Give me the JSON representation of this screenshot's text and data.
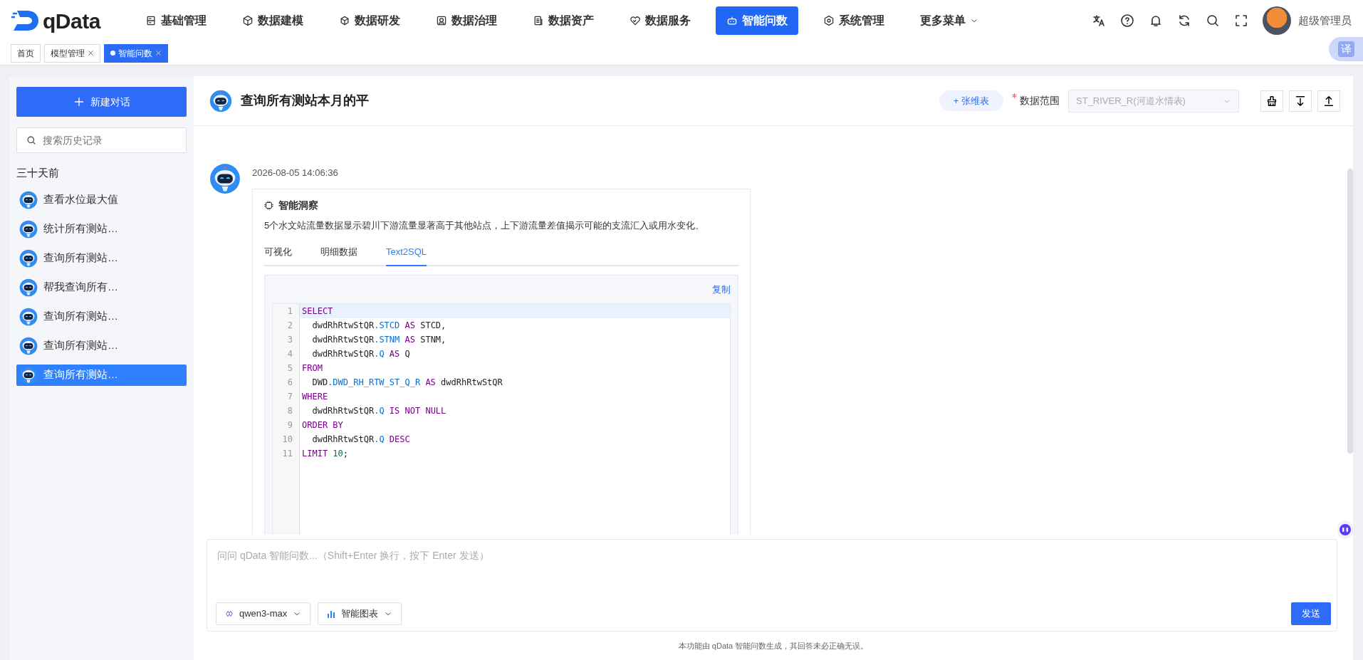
{
  "logo": {
    "text": "qData"
  },
  "nav": [
    {
      "label": "基础管理",
      "kind": "server",
      "selected": false
    },
    {
      "label": "数据建模",
      "kind": "cube",
      "selected": false
    },
    {
      "label": "数据研发",
      "kind": "box",
      "selected": false
    },
    {
      "label": "数据治理",
      "kind": "frame",
      "selected": false
    },
    {
      "label": "数据资产",
      "kind": "doc",
      "selected": false
    },
    {
      "label": "数据服务",
      "kind": "heart",
      "selected": false
    },
    {
      "label": "智能问数",
      "kind": "robot",
      "selected": true
    },
    {
      "label": "系统管理",
      "kind": "hex",
      "selected": false
    }
  ],
  "more_menu": {
    "label": "更多菜单"
  },
  "user": {
    "name": "超级管理员"
  },
  "translate_button": {
    "label": "译"
  },
  "page_tabs": [
    {
      "label": "首页",
      "closable": false,
      "selected": false
    },
    {
      "label": "模型管理",
      "closable": true,
      "selected": false
    },
    {
      "label": "智能问数",
      "closable": true,
      "selected": true
    }
  ],
  "sidebar": {
    "new_button": "新建对话",
    "search_placeholder": "搜索历史记录",
    "group": "三十天前",
    "items": [
      {
        "label": "查看水位最大值",
        "selected": false
      },
      {
        "label": "统计所有测站…",
        "selected": false
      },
      {
        "label": "查询所有测站…",
        "selected": false
      },
      {
        "label": "帮我查询所有…",
        "selected": false
      },
      {
        "label": "查询所有测站…",
        "selected": false
      },
      {
        "label": "查询所有测站…",
        "selected": false
      },
      {
        "label": "查询所有测站…",
        "selected": true
      }
    ]
  },
  "header": {
    "title": "查询所有测站本月的平",
    "user_tag": "+ 张维表",
    "scope_label": "数据范围",
    "scope_value": "ST_RIVER_R(河道水情表)"
  },
  "message": {
    "time": "2026-08-05 14:06:36",
    "insight_title": "智能洞察",
    "insight": "5个水文站流量数据显示碧川下游流量显著高于其他站点，上下游流量差值揭示可能的支流汇入或用水变化。",
    "tabs": [
      {
        "label": "可视化",
        "selected": false
      },
      {
        "label": "明细数据",
        "selected": false
      },
      {
        "label": "Text2SQL",
        "selected": true
      }
    ],
    "copy": "复制",
    "code": [
      {
        "n": "1",
        "active": true,
        "tokens": [
          {
            "t": "SELECT",
            "kind": "keyword"
          }
        ]
      },
      {
        "n": "2",
        "active": false,
        "tokens": [
          {
            "t": "  dwdRhRtwStQR",
            "kind": "plain"
          },
          {
            "t": ".STCD",
            "kind": "field"
          },
          {
            "t": " AS",
            "kind": "keyword"
          },
          {
            "t": " STCD,",
            "kind": "plain"
          }
        ]
      },
      {
        "n": "3",
        "active": false,
        "tokens": [
          {
            "t": "  dwdRhRtwStQR",
            "kind": "plain"
          },
          {
            "t": ".STNM",
            "kind": "field"
          },
          {
            "t": " AS",
            "kind": "keyword"
          },
          {
            "t": " STNM,",
            "kind": "plain"
          }
        ]
      },
      {
        "n": "4",
        "active": false,
        "tokens": [
          {
            "t": "  dwdRhRtwStQR",
            "kind": "plain"
          },
          {
            "t": ".Q",
            "kind": "field"
          },
          {
            "t": " AS",
            "kind": "keyword"
          },
          {
            "t": " Q",
            "kind": "plain"
          }
        ]
      },
      {
        "n": "5",
        "active": false,
        "tokens": [
          {
            "t": "FROM",
            "kind": "keyword"
          }
        ]
      },
      {
        "n": "6",
        "active": false,
        "tokens": [
          {
            "t": "  DWD",
            "kind": "plain"
          },
          {
            "t": ".DWD_RH_RTW_ST_Q_R",
            "kind": "field"
          },
          {
            "t": " AS",
            "kind": "keyword"
          },
          {
            "t": " dwdRhRtwStQR",
            "kind": "plain"
          }
        ]
      },
      {
        "n": "7",
        "active": false,
        "tokens": [
          {
            "t": "WHERE",
            "kind": "keyword"
          }
        ]
      },
      {
        "n": "8",
        "active": false,
        "tokens": [
          {
            "t": "  dwdRhRtwStQR",
            "kind": "plain"
          },
          {
            "t": ".Q",
            "kind": "field"
          },
          {
            "t": " IS NOT NULL",
            "kind": "keyword"
          }
        ]
      },
      {
        "n": "9",
        "active": false,
        "tokens": [
          {
            "t": "ORDER BY",
            "kind": "keyword"
          }
        ]
      },
      {
        "n": "10",
        "active": false,
        "tokens": [
          {
            "t": "  dwdRhRtwStQR",
            "kind": "plain"
          },
          {
            "t": ".Q",
            "kind": "field"
          },
          {
            "t": " DESC",
            "kind": "keyword"
          }
        ]
      },
      {
        "n": "11",
        "active": false,
        "tokens": [
          {
            "t": "LIMIT",
            "kind": "keyword"
          },
          {
            "t": " 10",
            "kind": "number"
          },
          {
            "t": ";",
            "kind": "plain"
          }
        ]
      }
    ]
  },
  "input": {
    "placeholder": "问问 qData 智能问数...（Shift+Enter 换行，按下 Enter 发送）",
    "model": "qwen3-max",
    "mode": "智能图表",
    "send": "发送"
  },
  "footer": "本功能由 qData 智能问数生成，其回答未必正确无误。"
}
